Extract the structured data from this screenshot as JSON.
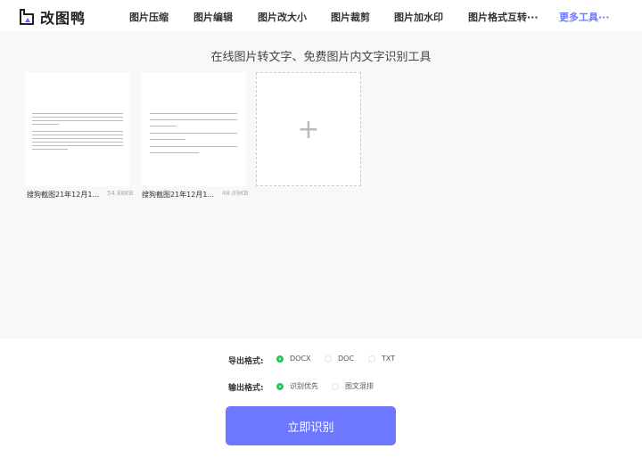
{
  "header": {
    "logo": "改图鸭",
    "nav": [
      "图片压缩",
      "图片编辑",
      "图片改大小",
      "图片裁剪",
      "图片加水印",
      "图片格式互转···"
    ],
    "more": "更多工具···"
  },
  "main": {
    "title": "在线图片转文字、免费图片内文字识别工具",
    "files": [
      {
        "name": "搜狗截图21年12月1...",
        "size": "54.88KB"
      },
      {
        "name": "搜狗截图21年12月1...",
        "size": "48.09KB"
      }
    ],
    "add_icon": "plus-icon"
  },
  "options": {
    "export_label": "导出格式:",
    "export": [
      "DOCX",
      "DOC",
      "TXT"
    ],
    "export_selected": 0,
    "output_label": "输出格式:",
    "output": [
      "识别优先",
      "图文混排"
    ],
    "output_selected": 0
  },
  "submit": "立即识别",
  "colors": {
    "accent": "#6b78ff",
    "radio": "#22c55e",
    "more": "#6b78ff"
  }
}
